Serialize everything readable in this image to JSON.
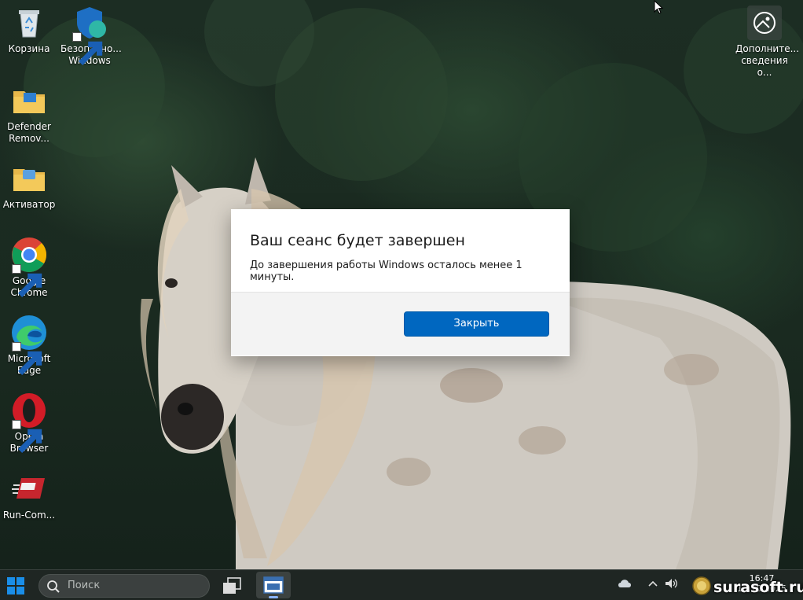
{
  "desktop": {
    "icons_left": [
      {
        "name": "recycle-bin",
        "label": "Корзина"
      },
      {
        "name": "defender-remover",
        "label": "Defender Remov..."
      },
      {
        "name": "activator",
        "label": "Активатор"
      },
      {
        "name": "google-chrome",
        "label_line1": "Google",
        "label_line2": "Chrome"
      },
      {
        "name": "microsoft-edge",
        "label_line1": "Microsoft",
        "label_line2": "Edge"
      },
      {
        "name": "opera-browser",
        "label_line1": "Opera",
        "label_line2": "Browser"
      },
      {
        "name": "run-command",
        "label": "Run-Com..."
      }
    ],
    "icon_security": {
      "label_line1": "Безопасно...",
      "label_line2": "Windows"
    },
    "icon_info": {
      "label_line1": "Дополните...",
      "label_line2": "сведения о..."
    }
  },
  "dialog": {
    "title": "Ваш сеанс будет завершен",
    "message": "До завершения работы Windows осталось менее 1 минуты.",
    "close_button": "Закрыть"
  },
  "taskbar": {
    "search_placeholder": "Поиск",
    "clock_time": "16:47",
    "clock_date": "13.10.2025"
  },
  "watermark": {
    "text": "surasoft.ru"
  },
  "colors": {
    "accent": "#0067c0",
    "taskbar": "#202624"
  }
}
